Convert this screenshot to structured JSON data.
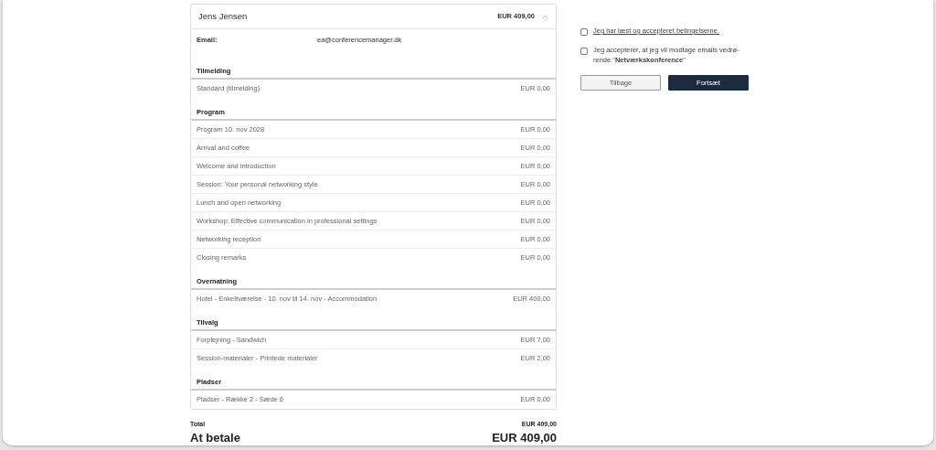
{
  "attendee": {
    "name": "Jens Jensen",
    "total": "EUR 409,00",
    "expanded": true
  },
  "email": {
    "label": "Email:",
    "value": "ea@conferencemanager.dk"
  },
  "sections": [
    {
      "title": "Tilmelding",
      "items": [
        {
          "label": "Standard (tilmelding)",
          "price": "EUR 0,00"
        }
      ]
    },
    {
      "title": "Program",
      "items": [
        {
          "label": "Program 10. nov 2028",
          "price": "EUR 0,00"
        },
        {
          "label": "Arrival and coffee",
          "price": "EUR 0,00"
        },
        {
          "label": "Welcome and introduction",
          "price": "EUR 0,00"
        },
        {
          "label": "Session: Your personal networking style",
          "price": "EUR 0,00"
        },
        {
          "label": "Lunch and open networking",
          "price": "EUR 0,00"
        },
        {
          "label": "Workshop: Effective communication in professional settings",
          "price": "EUR 0,00"
        },
        {
          "label": "Networking reception",
          "price": "EUR 0,00"
        },
        {
          "label": "Closing remarks",
          "price": "EUR 0,00"
        }
      ]
    },
    {
      "title": "Overnatning",
      "items": [
        {
          "label": "Hotel - Enkeltværelse - 10. nov til 14. nov - Accommodation",
          "price": "EUR 400,00"
        }
      ]
    },
    {
      "title": "Tilvalg",
      "items": [
        {
          "label": "Forplejning - Sandwich",
          "price": "EUR 7,00"
        },
        {
          "label": "Session-materialer - Printede materialer",
          "price": "EUR 2,00"
        }
      ]
    },
    {
      "title": "Pladser",
      "items": [
        {
          "label": "Pladser - Række 2 - Sæde 6",
          "price": "EUR 0,00"
        }
      ]
    }
  ],
  "total": {
    "label": "Total",
    "value": "EUR 409,00"
  },
  "to_pay": {
    "label": "At betale",
    "value": "EUR 409,00"
  },
  "consents": [
    {
      "kind": "link",
      "text": "Jeg har læst og accepteret betingelserne.",
      "checked": false
    },
    {
      "kind": "text",
      "text": "Jeg accepterer, at jeg vil modtage emails vedrø-rende \"**Netværkskonference**\"",
      "checked": false
    }
  ],
  "buttons": [
    {
      "kind": "secondary",
      "label": "Tilbage"
    },
    {
      "kind": "primary",
      "label": "Fortsæt"
    }
  ]
}
